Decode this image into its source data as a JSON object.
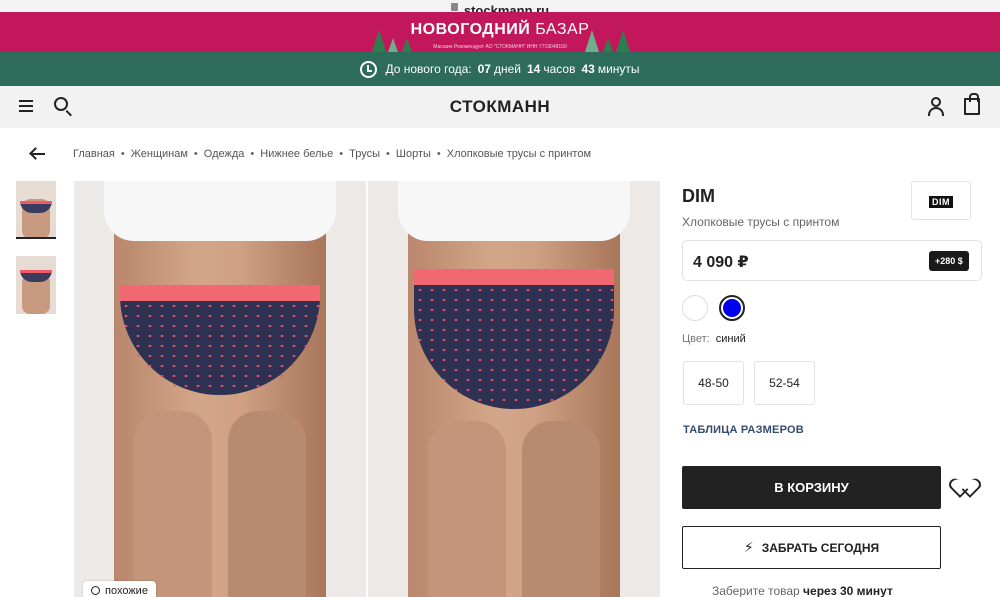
{
  "browser": {
    "url": "stockmann.ru"
  },
  "promo": {
    "title_bold": "НОВОГОДНИЙ",
    "title_thin": "БАЗАР",
    "subtitle": "Магазин Рекомендует АО \"СТОКМАНН\" ИНН 7719048150"
  },
  "countdown": {
    "prefix": "До нового года:",
    "days": "07",
    "days_label": "дней",
    "hours": "14",
    "hours_label": "часов",
    "minutes": "43",
    "minutes_label": "минуты"
  },
  "header": {
    "logo": "СТОКМАНН"
  },
  "breadcrumbs": {
    "items": [
      "Главная",
      "Женщинам",
      "Одежда",
      "Нижнее белье",
      "Трусы",
      "Шорты",
      "Хлопковые трусы с принтом"
    ],
    "separator": "•"
  },
  "gallery": {
    "similar_label": "похожие"
  },
  "product": {
    "brand": "DIM",
    "brand_logo_text": "DIM",
    "name": "Хлопковые трусы с принтом",
    "price": "4 090 ₽",
    "bonus": "+280",
    "bonus_symbol": "$",
    "colors": [
      {
        "name": "белый",
        "hex": "#ffffff",
        "selected": false
      },
      {
        "name": "синий",
        "hex": "#0000ee",
        "selected": true
      }
    ],
    "color_label": "Цвет:",
    "color_value": "синий",
    "sizes": [
      "48-50",
      "52-54"
    ],
    "size_table_link": "ТАБЛИЦА РАЗМЕРОВ",
    "add_to_cart": "В КОРЗИНУ",
    "pickup_today": "ЗАБРАТЬ СЕГОДНЯ",
    "pickup_note_prefix": "Заберите товар",
    "pickup_note_bold": "через 30 минут"
  },
  "colors": {
    "promo_bg": "#c2185b",
    "countdown_bg": "#2d6b5b",
    "header_bg": "#f2f2f2",
    "primary_button": "#222222",
    "link": "#344c6e"
  },
  "icons": [
    "clock-icon",
    "menu-icon",
    "search-icon",
    "user-icon",
    "cart-icon",
    "back-arrow-icon",
    "heart-icon",
    "lightning-icon"
  ]
}
